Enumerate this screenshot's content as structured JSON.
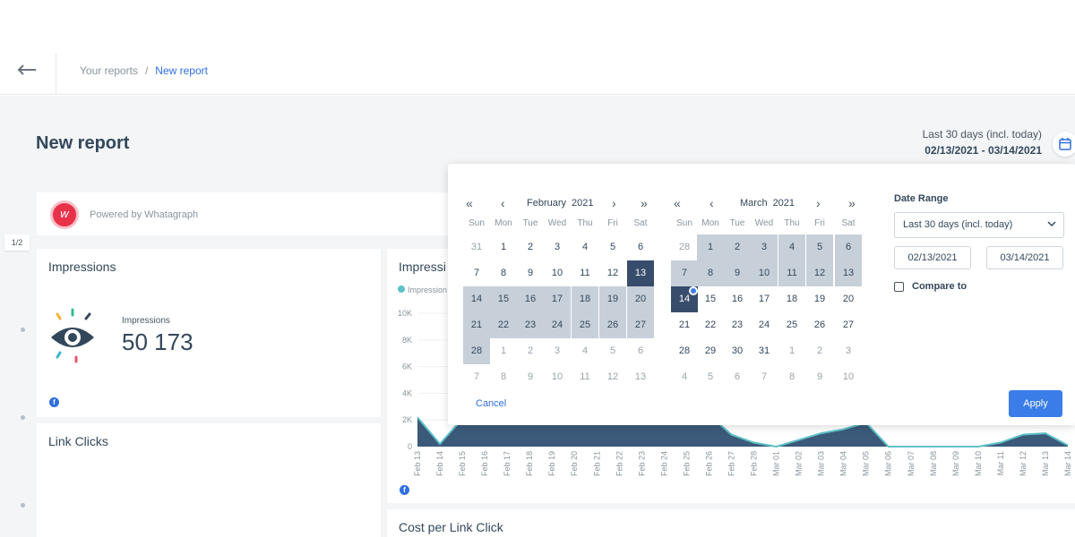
{
  "breadcrumb": {
    "parent": "Your reports",
    "separator": "/",
    "current": "New report"
  },
  "page": {
    "title": "New report"
  },
  "range_summary": {
    "label": "Last 30 days (incl. today)",
    "dates": "02/13/2021 - 03/14/2021"
  },
  "powered": {
    "text": "Powered by Whatagraph",
    "logo_letter": "w"
  },
  "page_indicator": "1/2",
  "cards": {
    "impressions_title": "Impressions",
    "impressions_label": "Impressions",
    "impressions_value": "50 173",
    "chart_title": "Impressi",
    "chart_legend": "Impression",
    "link_clicks_title": "Link Clicks",
    "cpc_title": "Cost per Link Click",
    "fb_letter": "f"
  },
  "chart_data": {
    "type": "area",
    "ylim": [
      0,
      10000
    ],
    "y_ticks": [
      "10K",
      "8K",
      "6K",
      "4K",
      "2K",
      "0"
    ],
    "x": [
      "Feb 13",
      "Feb 14",
      "Feb 15",
      "Feb 16",
      "Feb 17",
      "Feb 18",
      "Feb 19",
      "Feb 20",
      "Feb 21",
      "Feb 22",
      "Feb 23",
      "Feb 24",
      "Feb 25",
      "Feb 26",
      "Feb 27",
      "Feb 28",
      "Mar 01",
      "Mar 02",
      "Mar 03",
      "Mar 04",
      "Mar 05",
      "Mar 06",
      "Mar 07",
      "Mar 08",
      "Mar 09",
      "Mar 10",
      "Mar 11",
      "Mar 12",
      "Mar 13",
      "Mar 14"
    ],
    "series": [
      {
        "name": "Impression",
        "values": [
          2200,
          200,
          2100,
          2300,
          2400,
          2200,
          2300,
          2300,
          2200,
          2300,
          2400,
          2300,
          2500,
          2400,
          900,
          300,
          0,
          500,
          1000,
          1300,
          1800,
          0,
          0,
          0,
          0,
          0,
          300,
          900,
          1000,
          100
        ]
      }
    ],
    "colors": {
      "fill": "#3b5a7a",
      "line": "#5ec1c7"
    }
  },
  "picker": {
    "nav": {
      "prev_year": "«",
      "prev_month": "‹",
      "next_month": "›",
      "next_year": "»"
    },
    "weekdays": [
      "Sun",
      "Mon",
      "Tue",
      "Wed",
      "Thu",
      "Fri",
      "Sat"
    ],
    "months": [
      {
        "name": "February",
        "year": "2021",
        "weeks": [
          [
            {
              "d": "31",
              "m": 1
            },
            {
              "d": "1"
            },
            {
              "d": "2"
            },
            {
              "d": "3"
            },
            {
              "d": "4"
            },
            {
              "d": "5"
            },
            {
              "d": "6"
            }
          ],
          [
            {
              "d": "7"
            },
            {
              "d": "8"
            },
            {
              "d": "9"
            },
            {
              "d": "10"
            },
            {
              "d": "11"
            },
            {
              "d": "12"
            },
            {
              "d": "13",
              "s": "edge"
            }
          ],
          [
            {
              "d": "14",
              "s": "in"
            },
            {
              "d": "15",
              "s": "in"
            },
            {
              "d": "16",
              "s": "in"
            },
            {
              "d": "17",
              "s": "in"
            },
            {
              "d": "18",
              "s": "in"
            },
            {
              "d": "19",
              "s": "in"
            },
            {
              "d": "20",
              "s": "in"
            }
          ],
          [
            {
              "d": "21",
              "s": "in"
            },
            {
              "d": "22",
              "s": "in"
            },
            {
              "d": "23",
              "s": "in"
            },
            {
              "d": "24",
              "s": "in"
            },
            {
              "d": "25",
              "s": "in"
            },
            {
              "d": "26",
              "s": "in"
            },
            {
              "d": "27",
              "s": "in"
            }
          ],
          [
            {
              "d": "28",
              "s": "in"
            },
            {
              "d": "1",
              "m": 1
            },
            {
              "d": "2",
              "m": 1
            },
            {
              "d": "3",
              "m": 1
            },
            {
              "d": "4",
              "m": 1
            },
            {
              "d": "5",
              "m": 1
            },
            {
              "d": "6",
              "m": 1
            }
          ],
          [
            {
              "d": "7",
              "m": 1
            },
            {
              "d": "8",
              "m": 1
            },
            {
              "d": "9",
              "m": 1
            },
            {
              "d": "10",
              "m": 1
            },
            {
              "d": "11",
              "m": 1
            },
            {
              "d": "12",
              "m": 1
            },
            {
              "d": "13",
              "m": 1
            }
          ]
        ]
      },
      {
        "name": "March",
        "year": "2021",
        "weeks": [
          [
            {
              "d": "28",
              "m": 1
            },
            {
              "d": "1",
              "s": "in"
            },
            {
              "d": "2",
              "s": "in"
            },
            {
              "d": "3",
              "s": "in"
            },
            {
              "d": "4",
              "s": "in"
            },
            {
              "d": "5",
              "s": "in"
            },
            {
              "d": "6",
              "s": "in"
            }
          ],
          [
            {
              "d": "7",
              "s": "in"
            },
            {
              "d": "8",
              "s": "in"
            },
            {
              "d": "9",
              "s": "in"
            },
            {
              "d": "10",
              "s": "in"
            },
            {
              "d": "11",
              "s": "in"
            },
            {
              "d": "12",
              "s": "in"
            },
            {
              "d": "13",
              "s": "in"
            }
          ],
          [
            {
              "d": "14",
              "s": "edge",
              "dot": 1
            },
            {
              "d": "15"
            },
            {
              "d": "16"
            },
            {
              "d": "17"
            },
            {
              "d": "18"
            },
            {
              "d": "19"
            },
            {
              "d": "20"
            }
          ],
          [
            {
              "d": "21"
            },
            {
              "d": "22"
            },
            {
              "d": "23"
            },
            {
              "d": "24"
            },
            {
              "d": "25"
            },
            {
              "d": "26"
            },
            {
              "d": "27"
            }
          ],
          [
            {
              "d": "28"
            },
            {
              "d": "29"
            },
            {
              "d": "30"
            },
            {
              "d": "31"
            },
            {
              "d": "1",
              "m": 1
            },
            {
              "d": "2",
              "m": 1
            },
            {
              "d": "3",
              "m": 1
            }
          ],
          [
            {
              "d": "4",
              "m": 1
            },
            {
              "d": "5",
              "m": 1
            },
            {
              "d": "6",
              "m": 1
            },
            {
              "d": "7",
              "m": 1
            },
            {
              "d": "8",
              "m": 1
            },
            {
              "d": "9",
              "m": 1
            },
            {
              "d": "10",
              "m": 1
            }
          ]
        ]
      }
    ],
    "date_range_label": "Date Range",
    "date_range_value": "Last 30 days (incl. today)",
    "start_date": "02/13/2021",
    "end_date": "03/14/2021",
    "compare_label": "Compare to",
    "compare_checked": false,
    "cancel_label": "Cancel",
    "apply_label": "Apply"
  }
}
